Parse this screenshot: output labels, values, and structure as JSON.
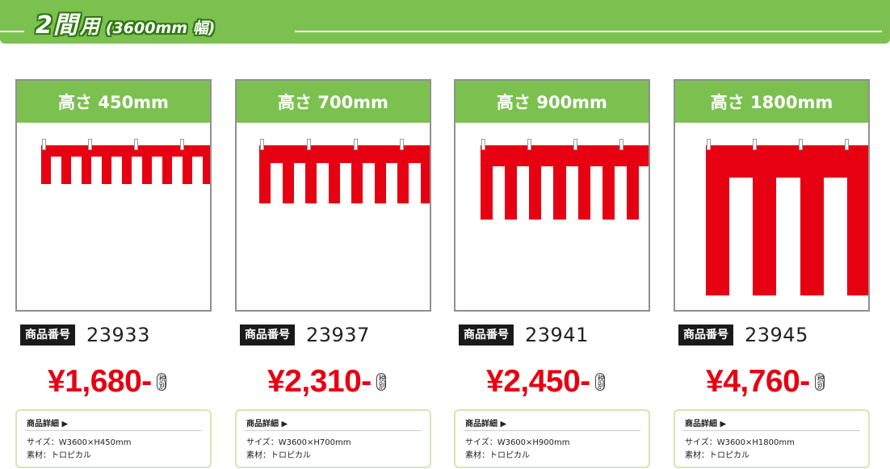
{
  "banner": {
    "main": "2間",
    "unit": "用",
    "width": "(3600mm 幅)",
    "color": "#7cc150"
  },
  "colors": {
    "accent_green": "#7cc150",
    "price_red": "#e60012",
    "label_dark": "#1a1a1a"
  },
  "common": {
    "code_label": "商品番号",
    "tax_note": "税別",
    "detail_heading": "商品詳細 ▶",
    "material": "素材：トロピカル"
  },
  "products": [
    {
      "height_title": "高さ 450mm",
      "code": "23933",
      "price": "¥1,680-",
      "size": "サイズ：W3600×H450mm"
    },
    {
      "height_title": "高さ 700mm",
      "code": "23937",
      "price": "¥2,310-",
      "size": "サイズ：W3600×H700mm"
    },
    {
      "height_title": "高さ 900mm",
      "code": "23941",
      "price": "¥2,450-",
      "size": "サイズ：W3600×H900mm"
    },
    {
      "height_title": "高さ 1800mm",
      "code": "23945",
      "price": "¥4,760-",
      "size": "サイズ：W3600×H1800mm"
    }
  ]
}
